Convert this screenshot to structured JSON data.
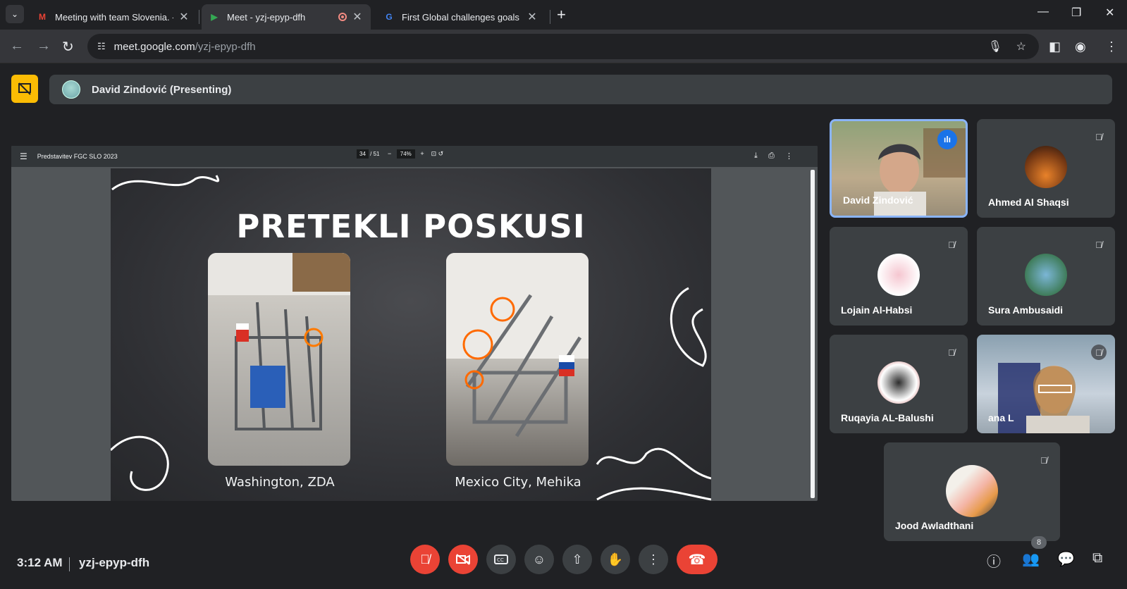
{
  "browser": {
    "tabs": [
      {
        "title": "Meeting with team Slovenia. - j",
        "active": false
      },
      {
        "title": "Meet - yzj-epyp-dfh",
        "active": true
      },
      {
        "title": "First Global challenges goals - C",
        "active": false
      }
    ],
    "url_host": "meet.google.com",
    "url_path": "/yzj-epyp-dfh"
  },
  "meet": {
    "presenter_label": "David Zindović (Presenting)",
    "pdf": {
      "doc_title": "Predstavitev FGC SLO 2023",
      "page_current": "34",
      "page_total": "/ 51",
      "zoom": "74%"
    },
    "slide": {
      "title": "PRETEKLI POSKUSI",
      "captions": [
        "Washington, ZDA",
        "Mexico City, Mehika"
      ]
    },
    "participants": [
      {
        "name": "David Zindović",
        "speaking": true
      },
      {
        "name": "Ahmed Al Shaqsi",
        "muted": true
      },
      {
        "name": "Lojain Al-Habsi",
        "muted": true
      },
      {
        "name": "Sura Ambusaidi",
        "muted": true
      },
      {
        "name": "Ruqayia AL-Balushi",
        "muted": true
      },
      {
        "name": "ana L",
        "muted": true
      },
      {
        "name": "Jood Awladthani",
        "muted": true
      }
    ],
    "time": "3:12 AM",
    "meeting_code": "yzj-epyp-dfh",
    "people_count": "8"
  },
  "colors": {
    "end_call": "#ea4335",
    "accent": "#8ab4f8",
    "present_badge": "#fbbc04"
  }
}
